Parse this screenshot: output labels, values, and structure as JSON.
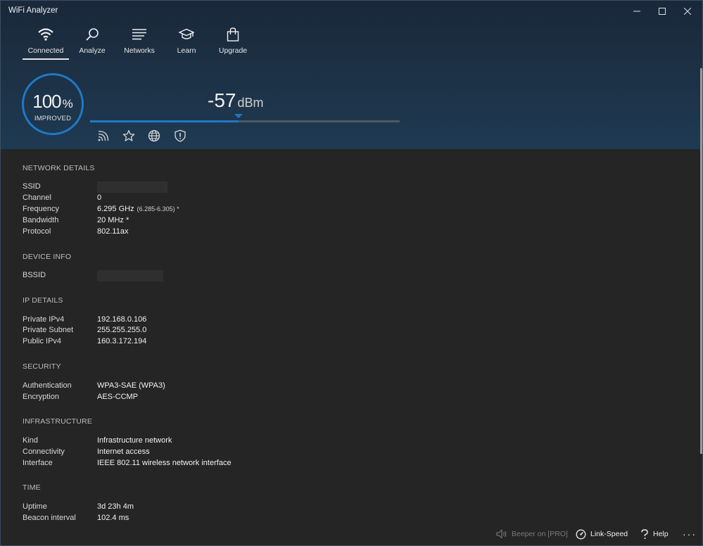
{
  "app": {
    "title": "WiFi Analyzer"
  },
  "nav": {
    "tabs": [
      {
        "label": "Connected",
        "icon": "wifi-icon",
        "active": true
      },
      {
        "label": "Analyze",
        "icon": "search-icon"
      },
      {
        "label": "Networks",
        "icon": "list-icon"
      },
      {
        "label": "Learn",
        "icon": "graduation-cap-icon"
      },
      {
        "label": "Upgrade",
        "icon": "shopping-bag-icon"
      }
    ]
  },
  "signal": {
    "percent": "100",
    "percent_unit": "%",
    "status": "IMPROVED",
    "dbm_value": "-57",
    "dbm_unit": "dBm",
    "bar_fill_fraction": 0.48
  },
  "quick_icons": [
    "signal-icon",
    "star-icon",
    "globe-icon",
    "shield-icon"
  ],
  "sections": {
    "network_details": {
      "title": "NETWORK DETAILS",
      "rows": [
        {
          "label": "SSID",
          "value": ""
        },
        {
          "label": "Channel",
          "value": "0"
        },
        {
          "label": "Frequency",
          "value": "6.295 GHz",
          "extra": "(6.285-6.305) *"
        },
        {
          "label": "Bandwidth",
          "value": "20 MHz *"
        },
        {
          "label": "Protocol",
          "value": "802.11ax"
        }
      ]
    },
    "device_info": {
      "title": "DEVICE INFO",
      "rows": [
        {
          "label": "BSSID",
          "value": ""
        }
      ]
    },
    "ip_details": {
      "title": "IP DETAILS",
      "rows": [
        {
          "label": "Private IPv4",
          "value": "192.168.0.106"
        },
        {
          "label": "Private Subnet",
          "value": "255.255.255.0"
        },
        {
          "label": "Public IPv4",
          "value": "160.3.172.194"
        }
      ]
    },
    "security": {
      "title": "SECURITY",
      "rows": [
        {
          "label": "Authentication",
          "value": "WPA3-SAE (WPA3)"
        },
        {
          "label": "Encryption",
          "value": "AES-CCMP"
        }
      ]
    },
    "infrastructure": {
      "title": "INFRASTRUCTURE",
      "rows": [
        {
          "label": "Kind",
          "value": "Infrastructure network"
        },
        {
          "label": "Connectivity",
          "value": "Internet access"
        },
        {
          "label": "Interface",
          "value": "IEEE 802.11 wireless network interface"
        }
      ]
    },
    "time": {
      "title": "TIME",
      "rows": [
        {
          "label": "Uptime",
          "value": "3d 23h 4m"
        },
        {
          "label": "Beacon interval",
          "value": "102.4 ms"
        }
      ]
    }
  },
  "bottom": {
    "beeper": "Beeper on [PRO]",
    "link_speed": "Link-Speed",
    "help": "Help",
    "more": "···"
  },
  "colors": {
    "accent": "#1f78c8",
    "header_bg": "#1d3044",
    "content_bg": "#2a2a2a"
  }
}
